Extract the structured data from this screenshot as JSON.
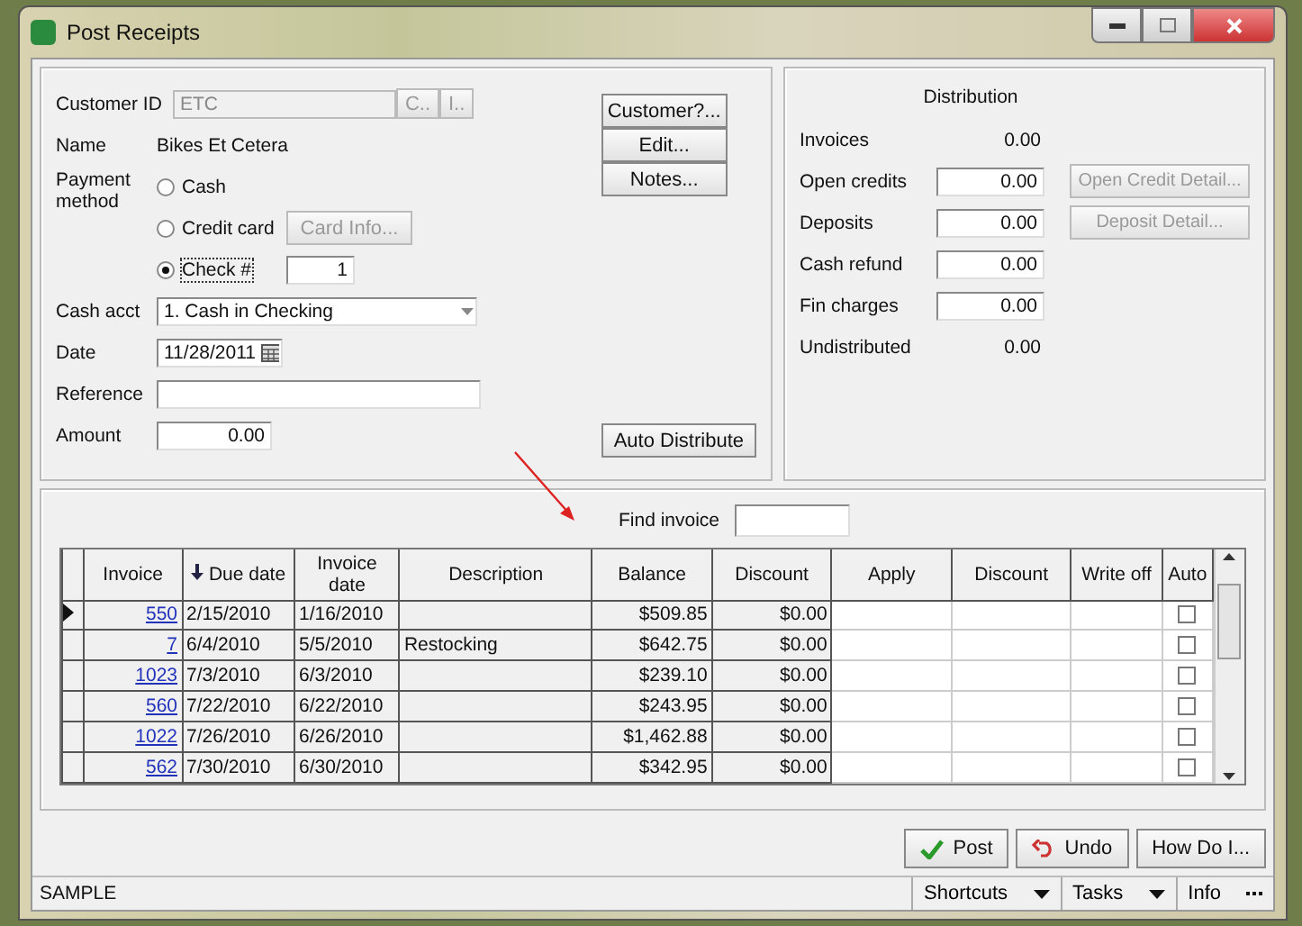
{
  "window": {
    "title": "Post Receipts"
  },
  "customer": {
    "id_label": "Customer ID",
    "id_value": "ETC",
    "id_buttons": [
      "C..",
      "I.."
    ],
    "name_label": "Name",
    "name_value": "Bikes Et Cetera"
  },
  "side_buttons": [
    "Customer?...",
    "Edit...",
    "Notes..."
  ],
  "payment": {
    "label": "Payment method",
    "methods": [
      {
        "label": "Cash",
        "selected": false
      },
      {
        "label": "Credit card",
        "selected": false,
        "button": "Card Info...",
        "button_disabled": true
      },
      {
        "label": "Check #",
        "selected": true,
        "value": "1"
      }
    ]
  },
  "cash_acct": {
    "label": "Cash acct",
    "value": "1. Cash in Checking"
  },
  "date": {
    "label": "Date",
    "value": "11/28/2011"
  },
  "reference": {
    "label": "Reference"
  },
  "amount": {
    "label": "Amount",
    "value": "0.00"
  },
  "auto_distribute": "Auto Distribute",
  "distribution": {
    "title": "Distribution",
    "rows": [
      {
        "label": "Invoices",
        "value": "0.00",
        "kind": "text"
      },
      {
        "label": "Open credits",
        "value": "0.00",
        "kind": "field",
        "button": "Open Credit Detail...",
        "button_disabled": true
      },
      {
        "label": "Deposits",
        "value": "0.00",
        "kind": "field",
        "button": "Deposit Detail...",
        "button_disabled": true
      },
      {
        "label": "Cash refund",
        "value": "0.00",
        "kind": "field"
      },
      {
        "label": "Fin charges",
        "value": "0.00",
        "kind": "field"
      },
      {
        "label": "Undistributed",
        "value": "0.00",
        "kind": "text"
      }
    ]
  },
  "find_invoice": {
    "label": "Find invoice"
  },
  "table": {
    "columns": [
      {
        "label": "Invoice",
        "sorted": false
      },
      {
        "label": "Due date",
        "sorted": true
      },
      {
        "label": "Invoice date",
        "sorted": false
      },
      {
        "label": "Description",
        "sorted": false
      },
      {
        "label": "Balance",
        "sorted": false
      },
      {
        "label": "Discount",
        "sorted": false
      },
      {
        "label": "Apply",
        "sorted": false
      },
      {
        "label": "Discount",
        "sorted": false
      },
      {
        "label": "Write off",
        "sorted": false
      },
      {
        "label": "Auto",
        "sorted": false
      }
    ],
    "rows": [
      {
        "invoice": "550",
        "due": "2/15/2010",
        "date": "1/16/2010",
        "description": "",
        "balance": "$509.85",
        "discount": "$0.00",
        "auto": false,
        "current": true
      },
      {
        "invoice": "7",
        "due": "6/4/2010",
        "date": "5/5/2010",
        "description": "Restocking",
        "balance": "$642.75",
        "discount": "$0.00",
        "auto": false,
        "current": false
      },
      {
        "invoice": "1023",
        "due": "7/3/2010",
        "date": "6/3/2010",
        "description": "",
        "balance": "$239.10",
        "discount": "$0.00",
        "auto": false,
        "current": false
      },
      {
        "invoice": "560",
        "due": "7/22/2010",
        "date": "6/22/2010",
        "description": "",
        "balance": "$243.95",
        "discount": "$0.00",
        "auto": false,
        "current": false
      },
      {
        "invoice": "1022",
        "due": "7/26/2010",
        "date": "6/26/2010",
        "description": "",
        "balance": "$1,462.88",
        "discount": "$0.00",
        "auto": false,
        "current": false
      },
      {
        "invoice": "562",
        "due": "7/30/2010",
        "date": "6/30/2010",
        "description": "",
        "balance": "$342.95",
        "discount": "$0.00",
        "auto": false,
        "current": false
      }
    ]
  },
  "actions": [
    {
      "label": "Post",
      "kind": "post"
    },
    {
      "label": "Undo",
      "kind": "undo"
    },
    {
      "label": "How Do I...",
      "kind": "plain"
    }
  ],
  "status_bar": {
    "text": "SAMPLE",
    "menus": [
      {
        "label": "Shortcuts",
        "kind": "dropdown"
      },
      {
        "label": "Tasks",
        "kind": "dropdown"
      },
      {
        "label": "Info",
        "kind": "more"
      }
    ]
  }
}
